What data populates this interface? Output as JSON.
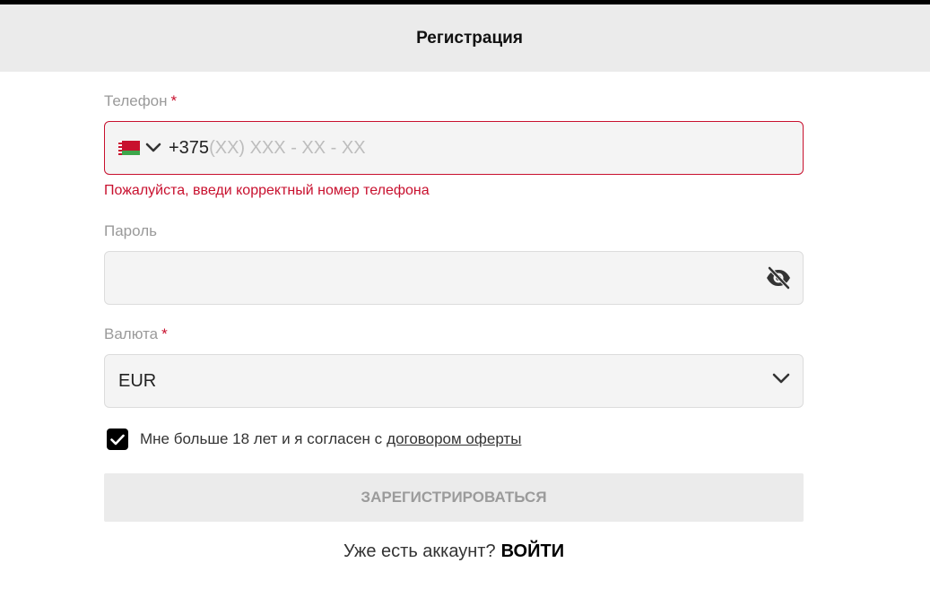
{
  "header": {
    "title": "Регистрация"
  },
  "phone": {
    "label": "Телефон",
    "required_mark": "*",
    "country_flag": "belarus-flag",
    "prefix": "+375",
    "mask_placeholder": "(XX) XXX - XX - XX",
    "error": "Пожалуйста, введи корректный номер телефона"
  },
  "password": {
    "label": "Пароль",
    "value": "",
    "toggle_icon": "eye-off-icon"
  },
  "currency": {
    "label": "Валюта",
    "required_mark": "*",
    "selected": "EUR"
  },
  "agreement": {
    "checked": true,
    "text": "Мне больше 18 лет и я согласен с",
    "link_text": "договором оферты"
  },
  "submit": {
    "label": "ЗАРЕГИСТРИРОВАТЬСЯ"
  },
  "login": {
    "prompt": "Уже есть аккаунт?",
    "link": "ВОЙТИ"
  },
  "colors": {
    "error": "#c8102e",
    "header_bg": "#ebebeb",
    "field_bg": "#f4f4f4"
  }
}
